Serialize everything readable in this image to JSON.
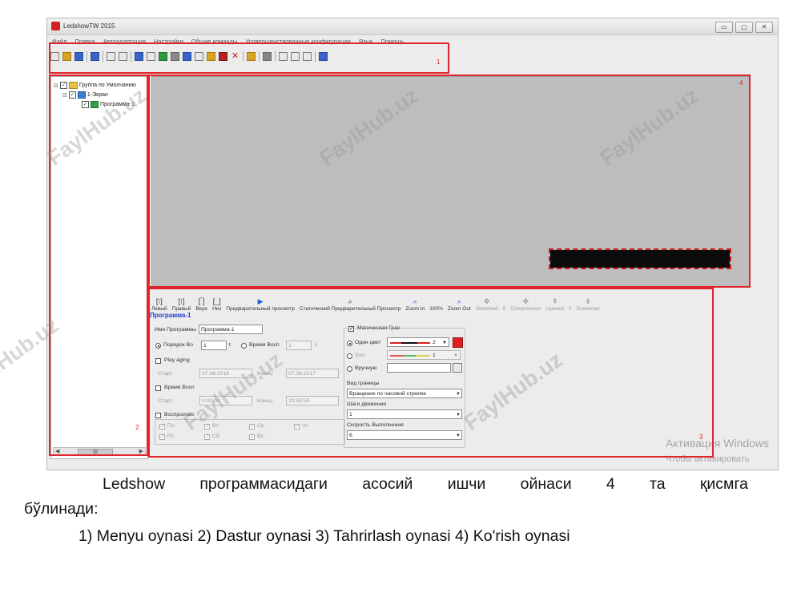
{
  "window": {
    "title": "LedshowTW 2015",
    "controls": [
      "▭",
      "▢",
      "✕"
    ]
  },
  "menu": [
    "Файл",
    "Правка",
    "Автоадаптация",
    "Настройки",
    "Общие команды",
    "Усовершенствованные конфигурации",
    "Язык",
    "Помощь"
  ],
  "tree": {
    "items": [
      "Группа по Умолчанию",
      "1-Экран",
      "Программа-1"
    ]
  },
  "edit_toolbar": {
    "items": [
      "Левый",
      "Правый",
      "Верх",
      "Низ",
      "Предварительный просмотр",
      "Статический Предварительный Просмотр",
      "Zoom In",
      "Zoom Out"
    ],
    "zoom": "100%",
    "disabled_items": [
      "Stretched",
      "Compression",
      "Upward",
      "Download"
    ],
    "zero": "0"
  },
  "program": {
    "title": "Программа-1",
    "name_label": "Имя Программы",
    "name_value": "Программа-1",
    "order_label": "Порядок Во",
    "order_value": "1",
    "order_unit": "t",
    "time_label": "Время Восп",
    "time_value": "1",
    "time_unit": "s",
    "play_aging": "Play aging",
    "start": "Старт",
    "end": "Конец",
    "start_date": "07.06.2016",
    "end_date": "07.06.2017",
    "play_time": "Время Восп",
    "start_time": "0:00:00",
    "end_time": "23:59:59",
    "playback": "Воспроизво",
    "days": [
      "Пн.",
      "Вт.",
      "Ср.",
      "Чт.",
      "Пт.",
      "Сб.",
      "Вс."
    ]
  },
  "magic": {
    "title": "Магическая Гран",
    "one_color": "Один цвет",
    "one_color_value": "2",
    "sun": "Sun",
    "sun_value": "1",
    "manual": "Вручную",
    "border_type_label": "Вид границы",
    "border_type_value": "Вращение по часовой стрелке",
    "steps_label": "Шаги движения",
    "steps_value": "1",
    "speed_label": "Скорость Выполнения",
    "speed_value": "6"
  },
  "annotations": [
    "1",
    "2",
    "3",
    "4"
  ],
  "watermark": "FaylHub.uz",
  "activation": {
    "line1": "Активация Windows",
    "line2": "Чтобы активировать"
  },
  "caption": {
    "line1": "Ledshow программасидаги асосий ишчи ойнаси 4 та қисмга",
    "line2": "бўлинади:",
    "line3": "1) Menyu oynasi 2) Dastur oynasi 3) Tahrirlash oynasi 4) Ko'rish oynasi"
  },
  "colors": {
    "accent_red": "#e1232b",
    "led_bg": "#0b0b0b",
    "preview_bg": "#bdbdbd"
  }
}
